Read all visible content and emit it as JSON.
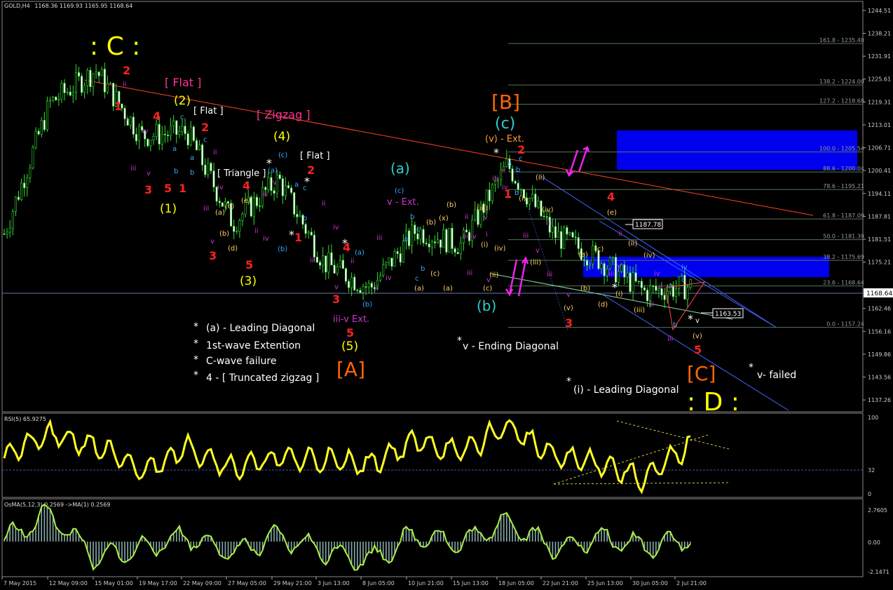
{
  "header": {
    "symbol_tf": "GOLD,H4",
    "ohlc": "1168.36 1169.93 1165.95 1168.64"
  },
  "price_axis": {
    "ticks": [
      "1244.51",
      "1238.21",
      "1231.91",
      "1225.61",
      "1219.31",
      "1213.01",
      "1206.71",
      "1200.41",
      "1194.11",
      "1187.81",
      "1181.51",
      "1175.21",
      "1168.64",
      "1162.46",
      "1156.16",
      "1149.86",
      "1143.56",
      "1137.26"
    ],
    "current": "1168.64"
  },
  "rsi": {
    "label": "RSI(5) 65.9275",
    "ticks": [
      "100",
      "32",
      "0"
    ]
  },
  "osma": {
    "label": "OsMA(5,12,3) 0.2569 ->MA(1) 0.2569",
    "ticks": [
      "2.7605",
      "0.00",
      "-2.1471"
    ]
  },
  "time_axis": [
    "7 May 2015",
    "12 May 09:00",
    "15 May 01:00",
    "19 May 17:00",
    "22 May 09:00",
    "27 May 05:00",
    "29 May 21:00",
    "3 Jun 13:00",
    "8 Jun 05:00",
    "10 Jun 21:00",
    "15 Jun 13:00",
    "18 Jun 05:00",
    "22 Jun 21:00",
    "25 Jun 13:00",
    "30 Jun 05:00",
    "2 Jul 21:00"
  ],
  "fibo": [
    {
      "label": "161.8 - 1235.40"
    },
    {
      "label": "138.2 - 1224.00"
    },
    {
      "label": "127.2 - 1218.68"
    },
    {
      "label": "100.0 - 1205.54"
    },
    {
      "label": "88.6 - 1200.04"
    },
    {
      "label": "78.6 - 1195.21"
    },
    {
      "label": "61.8 - 1187.09"
    },
    {
      "label": "50.0 - 1181.39"
    },
    {
      "label": "38.2 - 1175.69"
    },
    {
      "label": "23.6 - 1168.64"
    },
    {
      "label": "0.0 - 1157.24"
    }
  ],
  "price_boxes": [
    {
      "text": "1187.78"
    },
    {
      "text": "1163.53"
    }
  ],
  "legend_notes": [
    {
      "text": "(a) - Leading Diagonal"
    },
    {
      "text": "1st-wave Extention"
    },
    {
      "text": "C-wave failure"
    },
    {
      "text": "4 - [ Truncated zigzag ]"
    }
  ],
  "notes": [
    {
      "text": "v - Ending Diagonal"
    },
    {
      "text": "(i) - Leading Diagonal"
    },
    {
      "text": "v- failed"
    }
  ],
  "wave_labels": [
    {
      "text": ": C :",
      "color": "#ffff00"
    },
    {
      "text": "[ Flat ]",
      "color": "#ff3399"
    },
    {
      "text": "[ Zigzag ]",
      "color": "#ff3399"
    },
    {
      "text": "[ Flat ]",
      "color": "#ffffff"
    },
    {
      "text": "[ Flat ]",
      "color": "#ffffff"
    },
    {
      "text": "[ Triangle ]",
      "color": "#ffffff"
    },
    {
      "text": "[B]",
      "color": "#ff6600"
    },
    {
      "text": "[A]",
      "color": "#ff6600"
    },
    {
      "text": "[C]",
      "color": "#ff6600"
    },
    {
      "text": ": D :",
      "color": "#ffff00"
    },
    {
      "text": "(c)",
      "color": "#33cccc"
    },
    {
      "text": "(a)",
      "color": "#33cccc"
    },
    {
      "text": "(b)",
      "color": "#33cccc"
    },
    {
      "text": "(v) - Ext.",
      "color": "#ff9933"
    },
    {
      "text": "v - Ext.",
      "color": "#cc33cc"
    },
    {
      "text": "iii-v Ext.",
      "color": "#cc33cc"
    },
    {
      "text": "(2)",
      "color": "#ffff00"
    },
    {
      "text": "(4)",
      "color": "#ffff00"
    },
    {
      "text": "(1)",
      "color": "#ffff00"
    },
    {
      "text": "(3)",
      "color": "#ffff00"
    },
    {
      "text": "(5)",
      "color": "#ffff00"
    },
    {
      "text": "1",
      "color": "#ff2222"
    },
    {
      "text": "2",
      "color": "#ff2222"
    },
    {
      "text": "3",
      "color": "#ff2222"
    },
    {
      "text": "4",
      "color": "#ff2222"
    },
    {
      "text": "5",
      "color": "#ff2222"
    }
  ],
  "chart_data": {
    "type": "line",
    "subtype": "candlestick with Elliott wave annotations",
    "symbol": "GOLD",
    "timeframe": "H4",
    "ylim": [
      1134.0,
      1247.0
    ],
    "x": [
      "7 May",
      "12 May",
      "15 May",
      "19 May",
      "22 May",
      "27 May",
      "29 May",
      "3 Jun",
      "8 Jun",
      "10 Jun",
      "15 Jun",
      "18 Jun",
      "22 Jun",
      "25 Jun",
      "30 Jun",
      "2 Jul"
    ],
    "series": [
      {
        "values": [
          1183.0,
          1219.0,
          1228.0,
          1210.0,
          1211.0,
          1186.0,
          1198.0,
          1175.0,
          1168.0,
          1184.0,
          1180.0,
          1202.0,
          1183.0,
          1176.0,
          1167.0,
          1168.6
        ]
      }
    ],
    "fib_levels": [
      1235.4,
      1224.0,
      1218.68,
      1205.54,
      1200.04,
      1195.21,
      1187.09,
      1181.39,
      1175.69,
      1168.64,
      1157.24
    ],
    "rsi_values": [
      52,
      78,
      64,
      30,
      62,
      35,
      48,
      45,
      40,
      70,
      55,
      90,
      50,
      42,
      20,
      66
    ],
    "osma_values": [
      0.1,
      2.4,
      -1.5,
      -0.6,
      0.5,
      -1.0,
      0.4,
      -0.8,
      -1.6,
      0.6,
      -0.2,
      1.8,
      -0.6,
      0.3,
      -0.4,
      0.26
    ]
  }
}
